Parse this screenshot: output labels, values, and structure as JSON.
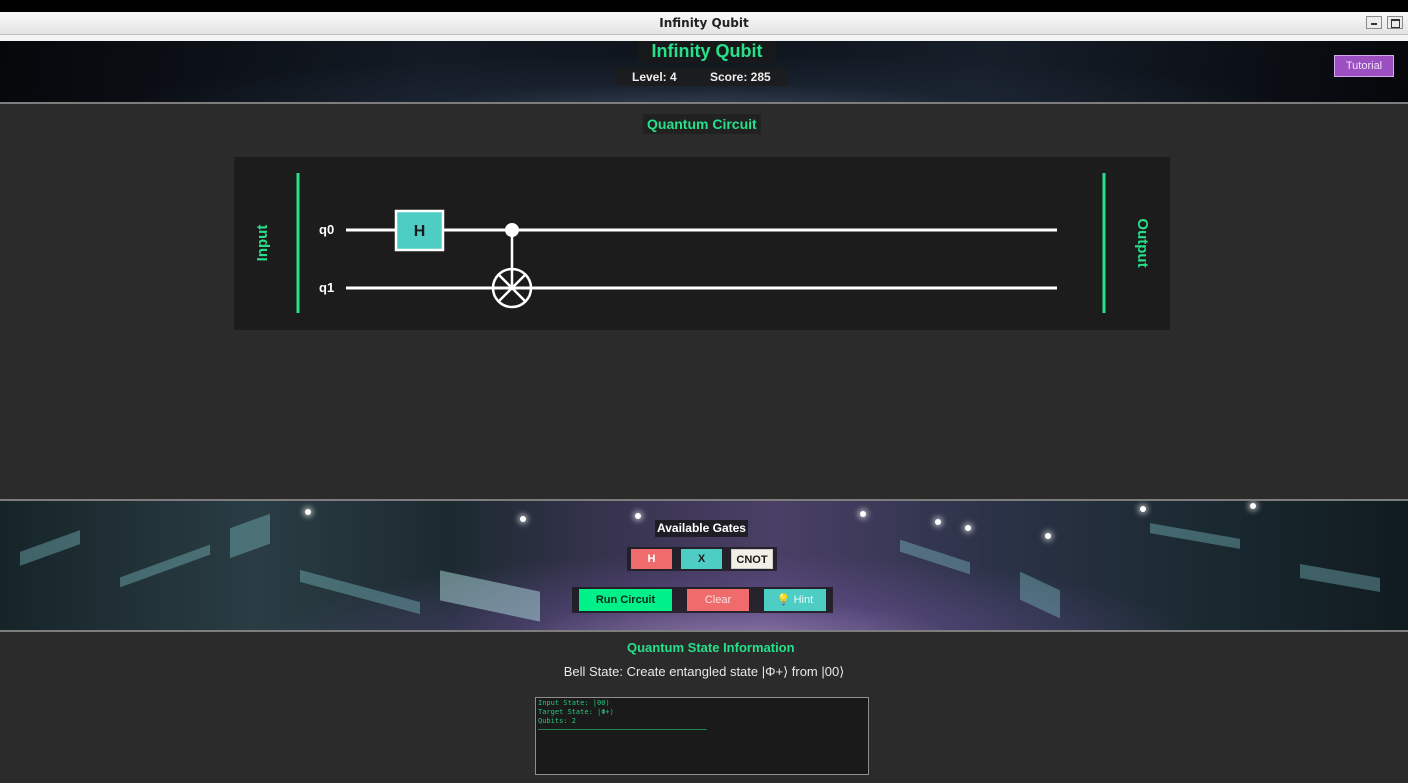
{
  "window": {
    "title": "Infinity Qubit"
  },
  "header": {
    "app_title": "Infinity Qubit",
    "level_text": "Level: 4",
    "score_text": "Score: 285",
    "tutorial_label": "Tutorial"
  },
  "circuit": {
    "section_title": "Quantum Circuit",
    "input_label": "Input",
    "output_label": "Output",
    "qubits": [
      "q0",
      "q1"
    ],
    "gates": [
      {
        "type": "H",
        "label": "H",
        "qubit": "q0"
      },
      {
        "type": "CNOT",
        "control": "q0",
        "target": "q1"
      }
    ]
  },
  "gates_panel": {
    "title": "Available Gates",
    "gates": [
      {
        "label": "H",
        "color": "#f06c6c"
      },
      {
        "label": "X",
        "color": "#4ecdc4"
      },
      {
        "label": "CNOT",
        "color": "#f2efe6"
      }
    ],
    "actions": [
      {
        "label": "Run Circuit",
        "color": "#00f08a"
      },
      {
        "label": "Clear",
        "color": "#f06c6c"
      },
      {
        "label": "💡 Hint",
        "color": "#4ecdc4"
      }
    ]
  },
  "info": {
    "section_title": "Quantum State Information",
    "description": "Bell State: Create entangled state |Φ+⟩ from |00⟩",
    "console_lines": [
      "Input State: |00⟩",
      "Target State: |Φ+⟩",
      "Qubits: 2",
      "────────────────────────────────────────"
    ]
  },
  "colors": {
    "accent": "#27e08a",
    "tutorial": "#9b4fc1",
    "gate_h": "#4ecdc4"
  }
}
